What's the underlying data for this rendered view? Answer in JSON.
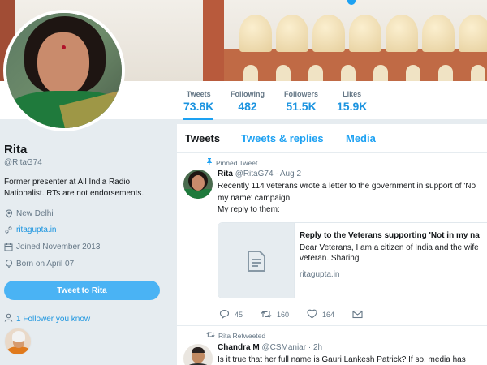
{
  "profile": {
    "name": "Rita",
    "handle": "@RitaG74",
    "bio_line1": "Former presenter at All India Radio.",
    "bio_line2": "Nationalist. RTs are not endorsements.",
    "location": "New Delhi",
    "website": "ritagupta.in",
    "joined": "Joined November 2013",
    "born": "Born on April 07",
    "tweet_to_label": "Tweet to Rita",
    "followers_you_know": "1 Follower you know"
  },
  "stats": [
    {
      "label": "Tweets",
      "value": "73.8K"
    },
    {
      "label": "Following",
      "value": "482"
    },
    {
      "label": "Followers",
      "value": "51.5K"
    },
    {
      "label": "Likes",
      "value": "15.9K"
    }
  ],
  "tabs": {
    "tweets": "Tweets",
    "replies": "Tweets & replies",
    "media": "Media"
  },
  "pinned_tweet": {
    "pinned_label": "Pinned Tweet",
    "author_name": "Rita",
    "author_handle": "@RitaG74",
    "date": "· Aug 2",
    "line1": "Recently 114 veterans wrote a letter to the government in support of 'No",
    "line2": "my name' campaign",
    "line3": "My reply to them:",
    "card_title": "Reply to the Veterans supporting 'Not in my na",
    "card_desc_line1": "Dear Veterans, I am a citizen of India and the wife",
    "card_desc_line2": "veteran. Sharing",
    "card_domain": "ritagupta.in",
    "replies": "45",
    "retweets": "160",
    "likes": "164"
  },
  "second_tweet": {
    "retweet_label": "Rita Retweeted",
    "author_name": "Chandra M",
    "author_handle": "@CSManiar",
    "date": "· 2h",
    "line1": "Is it true that her full name is Gauri Lankesh Patrick? If so, media has"
  },
  "colors": {
    "accent": "#1da1f2",
    "link": "#1b95e0",
    "button": "#4ab3f4",
    "page_bg": "#e6ecf0"
  }
}
